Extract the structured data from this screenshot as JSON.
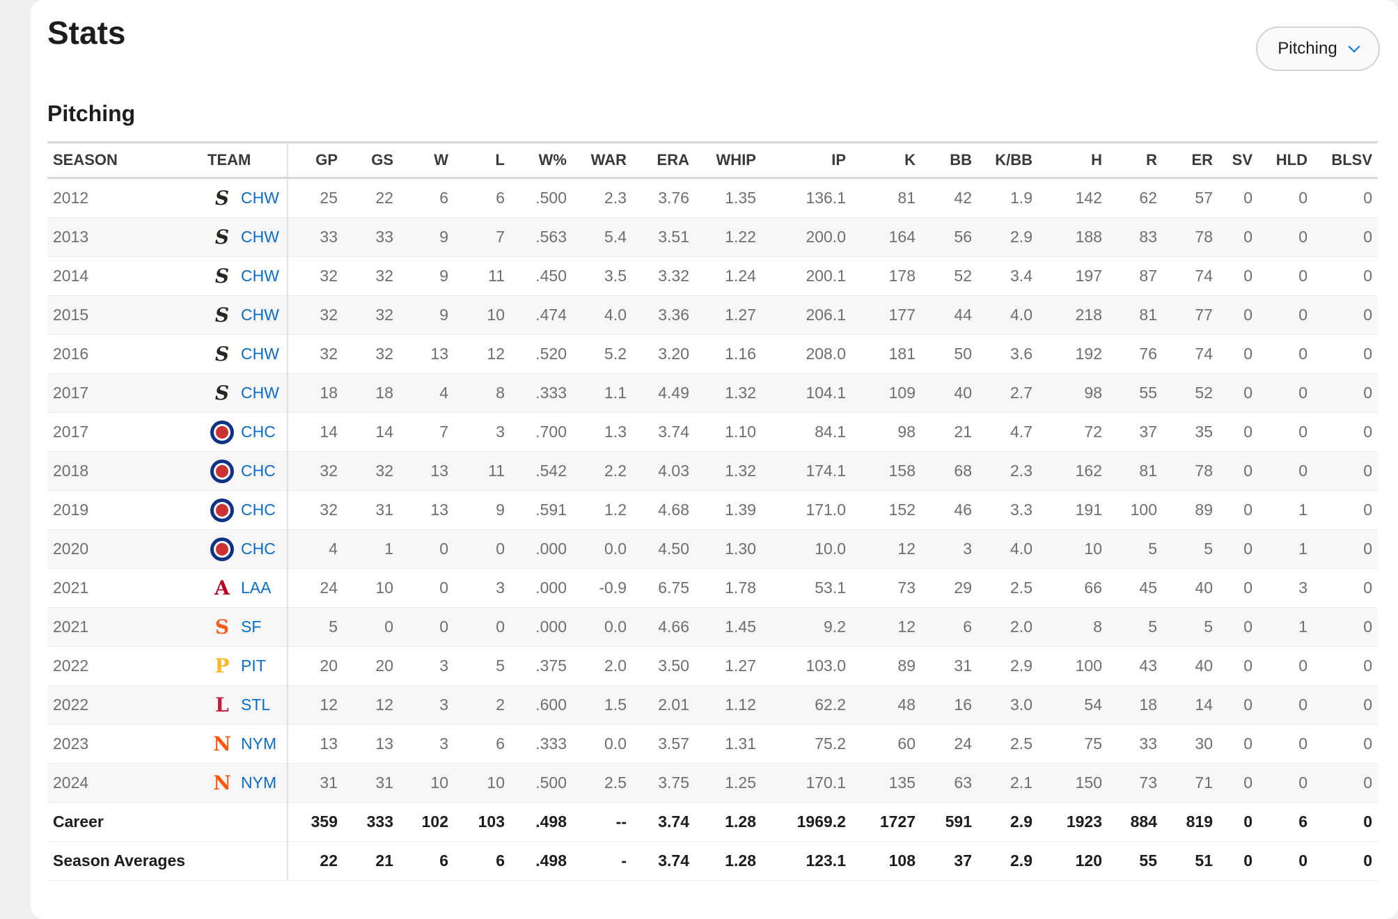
{
  "page_title": "Stats",
  "dropdown": {
    "selected": "Pitching"
  },
  "section_title": "Pitching",
  "colors": {
    "link": "#0a6cc9",
    "chw": "#27251f",
    "chc": "#0e3386",
    "laa": "#ba0021",
    "sf": "#fd5a1e",
    "pit": "#fdb827",
    "stl": "#c41e3a",
    "nym": "#ff5910"
  },
  "columns": [
    "SEASON",
    "TEAM",
    "GP",
    "GS",
    "W",
    "L",
    "W%",
    "WAR",
    "ERA",
    "WHIP",
    "IP",
    "K",
    "BB",
    "K/BB",
    "H",
    "R",
    "ER",
    "SV",
    "HLD",
    "BLSV"
  ],
  "rows": [
    {
      "season": "2012",
      "team": "CHW",
      "logo": "white-sox-logo",
      "stats": [
        "25",
        "22",
        "6",
        "6",
        ".500",
        "2.3",
        "3.76",
        "1.35",
        "136.1",
        "81",
        "42",
        "1.9",
        "142",
        "62",
        "57",
        "0",
        "0",
        "0"
      ]
    },
    {
      "season": "2013",
      "team": "CHW",
      "logo": "white-sox-logo",
      "stats": [
        "33",
        "33",
        "9",
        "7",
        ".563",
        "5.4",
        "3.51",
        "1.22",
        "200.0",
        "164",
        "56",
        "2.9",
        "188",
        "83",
        "78",
        "0",
        "0",
        "0"
      ]
    },
    {
      "season": "2014",
      "team": "CHW",
      "logo": "white-sox-logo",
      "stats": [
        "32",
        "32",
        "9",
        "11",
        ".450",
        "3.5",
        "3.32",
        "1.24",
        "200.1",
        "178",
        "52",
        "3.4",
        "197",
        "87",
        "74",
        "0",
        "0",
        "0"
      ]
    },
    {
      "season": "2015",
      "team": "CHW",
      "logo": "white-sox-logo",
      "stats": [
        "32",
        "32",
        "9",
        "10",
        ".474",
        "4.0",
        "3.36",
        "1.27",
        "206.1",
        "177",
        "44",
        "4.0",
        "218",
        "81",
        "77",
        "0",
        "0",
        "0"
      ]
    },
    {
      "season": "2016",
      "team": "CHW",
      "logo": "white-sox-logo",
      "stats": [
        "32",
        "32",
        "13",
        "12",
        ".520",
        "5.2",
        "3.20",
        "1.16",
        "208.0",
        "181",
        "50",
        "3.6",
        "192",
        "76",
        "74",
        "0",
        "0",
        "0"
      ]
    },
    {
      "season": "2017",
      "team": "CHW",
      "logo": "white-sox-logo",
      "stats": [
        "18",
        "18",
        "4",
        "8",
        ".333",
        "1.1",
        "4.49",
        "1.32",
        "104.1",
        "109",
        "40",
        "2.7",
        "98",
        "55",
        "52",
        "0",
        "0",
        "0"
      ]
    },
    {
      "season": "2017",
      "team": "CHC",
      "logo": "cubs-logo",
      "stats": [
        "14",
        "14",
        "7",
        "3",
        ".700",
        "1.3",
        "3.74",
        "1.10",
        "84.1",
        "98",
        "21",
        "4.7",
        "72",
        "37",
        "35",
        "0",
        "0",
        "0"
      ]
    },
    {
      "season": "2018",
      "team": "CHC",
      "logo": "cubs-logo",
      "stats": [
        "32",
        "32",
        "13",
        "11",
        ".542",
        "2.2",
        "4.03",
        "1.32",
        "174.1",
        "158",
        "68",
        "2.3",
        "162",
        "81",
        "78",
        "0",
        "0",
        "0"
      ]
    },
    {
      "season": "2019",
      "team": "CHC",
      "logo": "cubs-logo",
      "stats": [
        "32",
        "31",
        "13",
        "9",
        ".591",
        "1.2",
        "4.68",
        "1.39",
        "171.0",
        "152",
        "46",
        "3.3",
        "191",
        "100",
        "89",
        "0",
        "1",
        "0"
      ]
    },
    {
      "season": "2020",
      "team": "CHC",
      "logo": "cubs-logo",
      "stats": [
        "4",
        "1",
        "0",
        "0",
        ".000",
        "0.0",
        "4.50",
        "1.30",
        "10.0",
        "12",
        "3",
        "4.0",
        "10",
        "5",
        "5",
        "0",
        "1",
        "0"
      ]
    },
    {
      "season": "2021",
      "team": "LAA",
      "logo": "angels-logo",
      "stats": [
        "24",
        "10",
        "0",
        "3",
        ".000",
        "-0.9",
        "6.75",
        "1.78",
        "53.1",
        "73",
        "29",
        "2.5",
        "66",
        "45",
        "40",
        "0",
        "3",
        "0"
      ]
    },
    {
      "season": "2021",
      "team": "SF",
      "logo": "giants-logo",
      "stats": [
        "5",
        "0",
        "0",
        "0",
        ".000",
        "0.0",
        "4.66",
        "1.45",
        "9.2",
        "12",
        "6",
        "2.0",
        "8",
        "5",
        "5",
        "0",
        "1",
        "0"
      ]
    },
    {
      "season": "2022",
      "team": "PIT",
      "logo": "pirates-logo",
      "stats": [
        "20",
        "20",
        "3",
        "5",
        ".375",
        "2.0",
        "3.50",
        "1.27",
        "103.0",
        "89",
        "31",
        "2.9",
        "100",
        "43",
        "40",
        "0",
        "0",
        "0"
      ]
    },
    {
      "season": "2022",
      "team": "STL",
      "logo": "cardinals-logo",
      "stats": [
        "12",
        "12",
        "3",
        "2",
        ".600",
        "1.5",
        "2.01",
        "1.12",
        "62.2",
        "48",
        "16",
        "3.0",
        "54",
        "18",
        "14",
        "0",
        "0",
        "0"
      ]
    },
    {
      "season": "2023",
      "team": "NYM",
      "logo": "mets-logo",
      "stats": [
        "13",
        "13",
        "3",
        "6",
        ".333",
        "0.0",
        "3.57",
        "1.31",
        "75.2",
        "60",
        "24",
        "2.5",
        "75",
        "33",
        "30",
        "0",
        "0",
        "0"
      ]
    },
    {
      "season": "2024",
      "team": "NYM",
      "logo": "mets-logo",
      "stats": [
        "31",
        "31",
        "10",
        "10",
        ".500",
        "2.5",
        "3.75",
        "1.25",
        "170.1",
        "135",
        "63",
        "2.1",
        "150",
        "73",
        "71",
        "0",
        "0",
        "0"
      ]
    }
  ],
  "totals": [
    {
      "label": "Career",
      "stats": [
        "359",
        "333",
        "102",
        "103",
        ".498",
        "--",
        "3.74",
        "1.28",
        "1969.2",
        "1727",
        "591",
        "2.9",
        "1923",
        "884",
        "819",
        "0",
        "6",
        "0"
      ]
    },
    {
      "label": "Season Averages",
      "stats": [
        "22",
        "21",
        "6",
        "6",
        ".498",
        "-",
        "3.74",
        "1.28",
        "123.1",
        "108",
        "37",
        "2.9",
        "120",
        "55",
        "51",
        "0",
        "0",
        "0"
      ]
    }
  ]
}
